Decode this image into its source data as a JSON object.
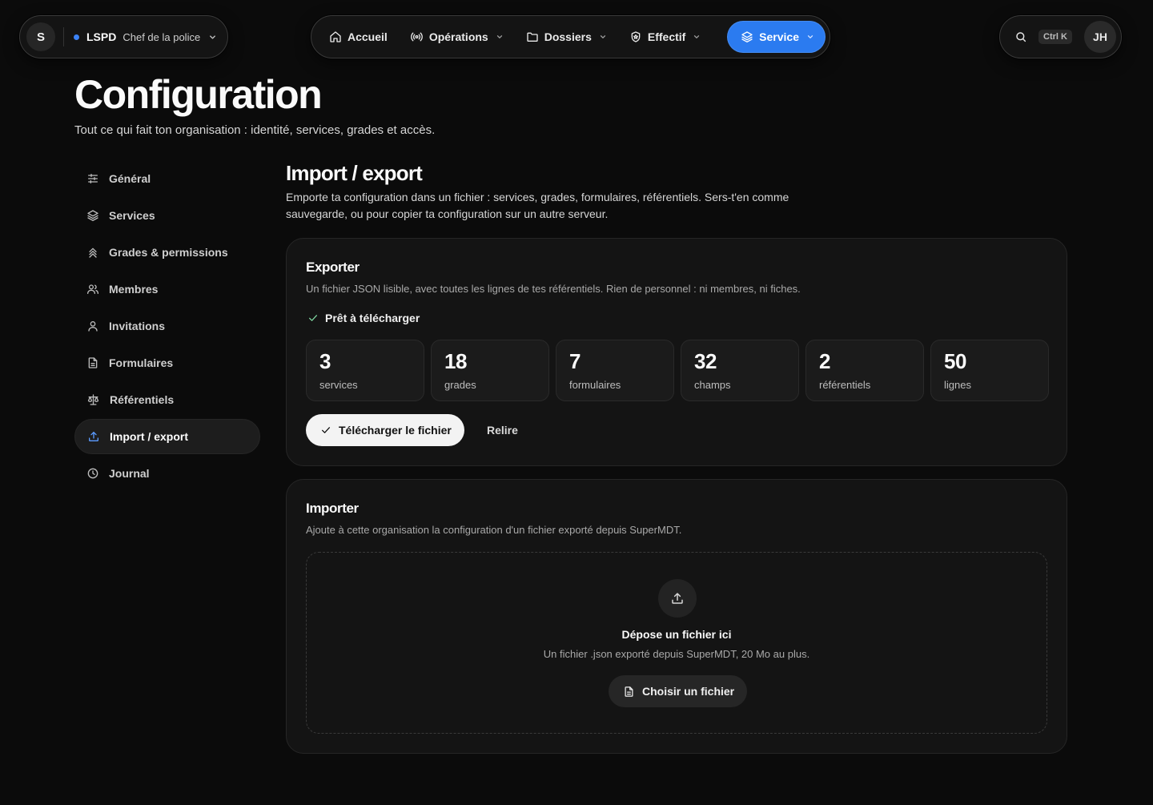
{
  "org": {
    "avatar_letter": "S",
    "name": "LSPD",
    "role": "Chef de la police",
    "status_color": "#3b82f6"
  },
  "nav": {
    "items": [
      {
        "label": "Accueil",
        "icon": "home-icon",
        "has_menu": false
      },
      {
        "label": "Opérations",
        "icon": "broadcast-icon",
        "has_menu": true
      },
      {
        "label": "Dossiers",
        "icon": "folder-icon",
        "has_menu": true
      },
      {
        "label": "Effectif",
        "icon": "badge-icon",
        "has_menu": true
      },
      {
        "label": "Service",
        "icon": "layers-icon",
        "has_menu": true,
        "active": true
      }
    ],
    "accent_color": "#2b7bf0"
  },
  "search": {
    "shortcut": "Ctrl K"
  },
  "user": {
    "initials": "JH"
  },
  "header": {
    "title": "Configuration",
    "subtitle": "Tout ce qui fait ton organisation : identité, services, grades et accès."
  },
  "sidebar": {
    "items": [
      {
        "label": "Général",
        "icon": "sliders-icon"
      },
      {
        "label": "Services",
        "icon": "layers-icon"
      },
      {
        "label": "Grades & permissions",
        "icon": "chevrons-up-icon"
      },
      {
        "label": "Membres",
        "icon": "users-icon"
      },
      {
        "label": "Invitations",
        "icon": "user-icon"
      },
      {
        "label": "Formulaires",
        "icon": "file-icon"
      },
      {
        "label": "Référentiels",
        "icon": "scale-icon"
      },
      {
        "label": "Import / export",
        "icon": "upload-icon",
        "active": true
      },
      {
        "label": "Journal",
        "icon": "clock-icon"
      }
    ]
  },
  "section": {
    "title": "Import / export",
    "description": "Emporte ta configuration dans un fichier : services, grades, formulaires, référentiels. Sers-t'en comme sauvegarde, ou pour copier ta configuration sur un autre serveur."
  },
  "export": {
    "title": "Exporter",
    "description": "Un fichier JSON lisible, avec toutes les lignes de tes référentiels. Rien de personnel : ni membres, ni fiches.",
    "status": "Prêt à télécharger",
    "stats": [
      {
        "value": "3",
        "label": "services"
      },
      {
        "value": "18",
        "label": "grades"
      },
      {
        "value": "7",
        "label": "formulaires"
      },
      {
        "value": "32",
        "label": "champs"
      },
      {
        "value": "2",
        "label": "référentiels"
      },
      {
        "value": "50",
        "label": "lignes"
      }
    ],
    "download_label": "Télécharger le fichier",
    "reread_label": "Relire"
  },
  "import": {
    "title": "Importer",
    "description": "Ajoute à cette organisation la configuration d'un fichier exporté depuis SuperMDT.",
    "drop_title": "Dépose un fichier ici",
    "drop_description": "Un fichier .json exporté depuis SuperMDT, 20 Mo au plus.",
    "choose_label": "Choisir un fichier"
  }
}
